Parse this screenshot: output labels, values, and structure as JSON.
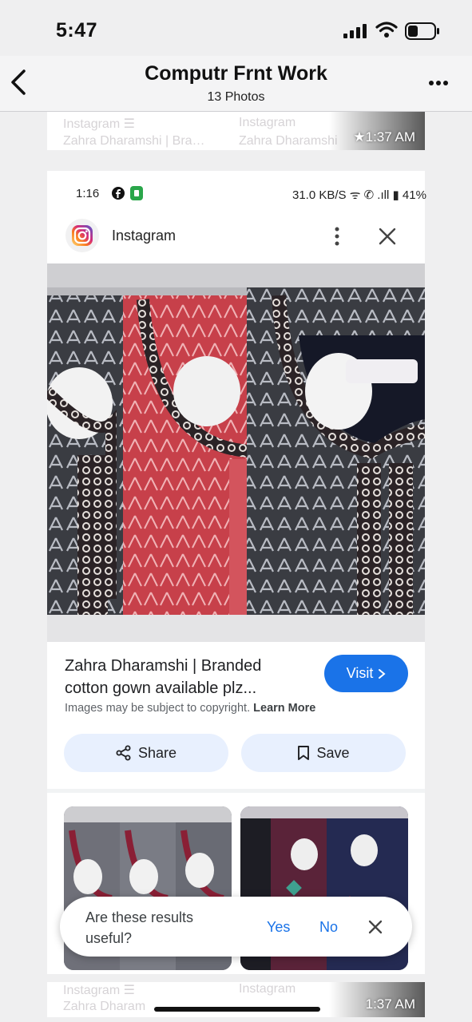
{
  "status_bar": {
    "time": "5:47",
    "icons": [
      "signal-icon",
      "wifi-icon",
      "battery-icon"
    ]
  },
  "nav": {
    "title": "Computr Frnt Work",
    "subtitle": "13 Photos",
    "back_icon": "chevron-left-icon",
    "more_icon": "ellipsis-icon"
  },
  "prev_strip": {
    "ghost_left": "Instagram  ☰",
    "ghost_left2": "Zahra Dharamshi | Bra…",
    "ghost_right": "Instagram",
    "ghost_right2": "Zahra Dharamshi",
    "timestamp": "★1:37 AM"
  },
  "phone_status": {
    "time": "1:16",
    "right": "31.0 KB/S  ᯤ  ✆  .ıll ▮ 41%"
  },
  "result": {
    "source": "Instagram",
    "title": "Zahra Dharamshi | Branded cotton gown available plz...",
    "visit": "Visit",
    "copyright": "Images may be subject to copyright.",
    "learn_more": "Learn More",
    "share": "Share",
    "save": "Save"
  },
  "feedback": {
    "question": "Are these results useful?",
    "yes": "Yes",
    "no": "No"
  },
  "next_strip": {
    "ghost_left": "Instagram  ☰",
    "ghost_left2": "Zahra Dharam",
    "ghost_right": "Instagram",
    "timestamp": "1:37 AM"
  },
  "colors": {
    "accent": "#1a73e8",
    "pill_bg": "#e8f0fe",
    "page_bg": "#efeff0"
  }
}
